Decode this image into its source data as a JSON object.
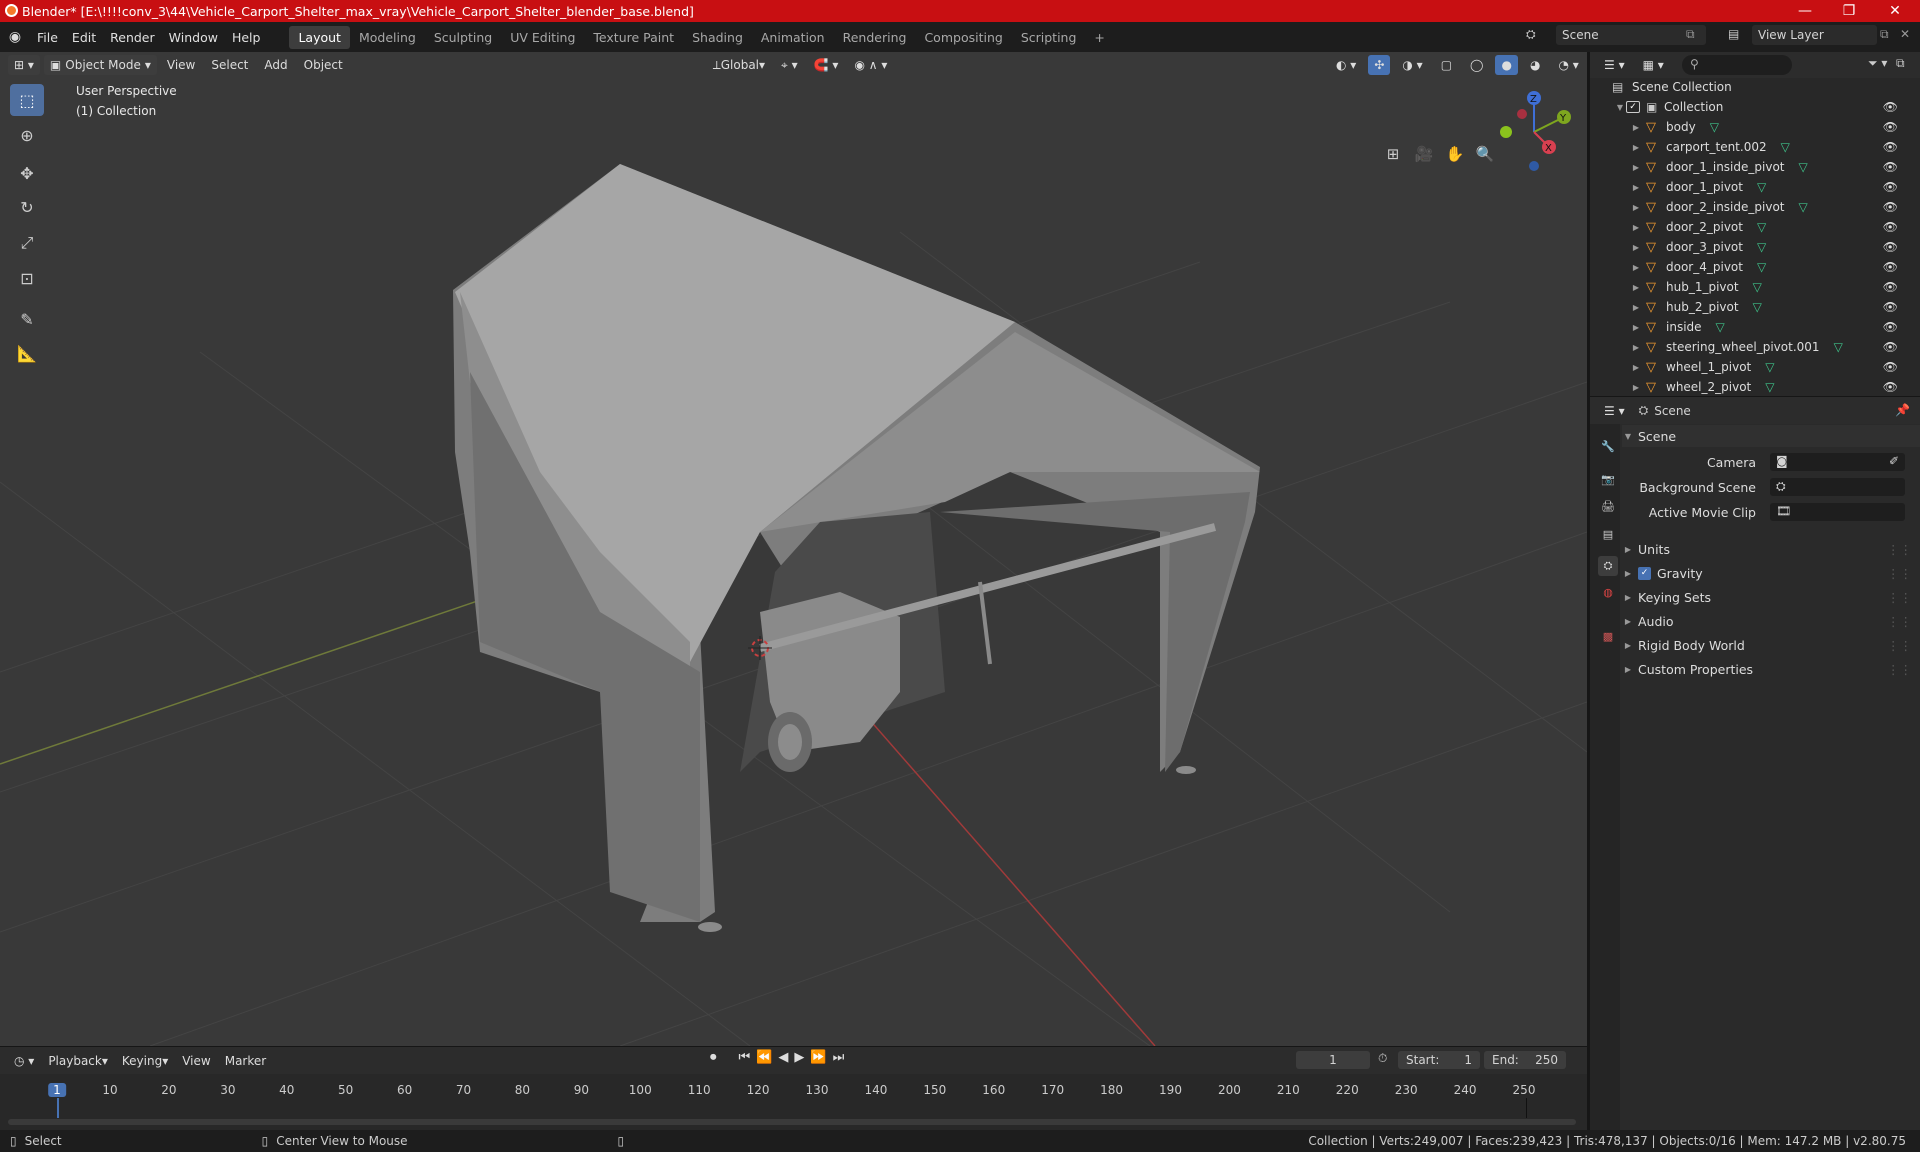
{
  "window": {
    "title": "Blender* [E:\\!!!!conv_3\\44\\Vehicle_Carport_Shelter_max_vray\\Vehicle_Carport_Shelter_blender_base.blend]",
    "min": "—",
    "max": "❐",
    "close": "✕"
  },
  "menu": [
    "File",
    "Edit",
    "Render",
    "Window",
    "Help"
  ],
  "workspaces": [
    "Layout",
    "Modeling",
    "Sculpting",
    "UV Editing",
    "Texture Paint",
    "Shading",
    "Animation",
    "Rendering",
    "Compositing",
    "Scripting"
  ],
  "workspace_add": "+",
  "scene_selector": "Scene",
  "view_layer": "View Layer",
  "viewport_header": {
    "mode": "Object Mode",
    "view": "View",
    "select": "Select",
    "add": "Add",
    "object": "Object",
    "orientation": "Global"
  },
  "viewport": {
    "perspective": "User Perspective",
    "collection": "(1) Collection"
  },
  "gizmo": {
    "x": "X",
    "y": "Y",
    "z": "Z"
  },
  "outliner": {
    "scene_collection": "Scene Collection",
    "collection": "Collection",
    "objects": [
      "body",
      "carport_tent.002",
      "door_1_inside_pivot",
      "door_1_pivot",
      "door_2_inside_pivot",
      "door_2_pivot",
      "door_3_pivot",
      "door_4_pivot",
      "hub_1_pivot",
      "hub_2_pivot",
      "inside",
      "steering_wheel_pivot.001",
      "wheel_1_pivot",
      "wheel_2_pivot"
    ]
  },
  "properties": {
    "header": "Scene",
    "panel": "Scene",
    "camera_label": "Camera",
    "background_scene_label": "Background Scene",
    "movie_clip_label": "Active Movie Clip",
    "subpanels": [
      "Units",
      "Gravity",
      "Keying Sets",
      "Audio",
      "Rigid Body World",
      "Custom Properties"
    ],
    "gravity_checked": true
  },
  "timeline": {
    "playback": "Playback",
    "keying": "Keying",
    "view": "View",
    "marker": "Marker",
    "current_frame": "1",
    "start_label": "Start:",
    "start": "1",
    "end_label": "End:",
    "end": "250",
    "ticks": [
      "1",
      "10",
      "20",
      "30",
      "40",
      "50",
      "60",
      "70",
      "80",
      "90",
      "100",
      "110",
      "120",
      "130",
      "140",
      "150",
      "160",
      "170",
      "180",
      "190",
      "200",
      "210",
      "220",
      "230",
      "240",
      "250"
    ]
  },
  "statusbar": {
    "select": "Select",
    "center_view": "Center View to Mouse",
    "stats": "Collection | Verts:249,007 | Faces:239,423 | Tris:478,137 | Objects:0/16 | Mem: 147.2 MB | v2.80.75"
  },
  "colors": {
    "title_bar": "#c80f12",
    "accent": "#4772b3",
    "object_icon": "#f09a32",
    "mesh_icon": "#3fc28a"
  }
}
